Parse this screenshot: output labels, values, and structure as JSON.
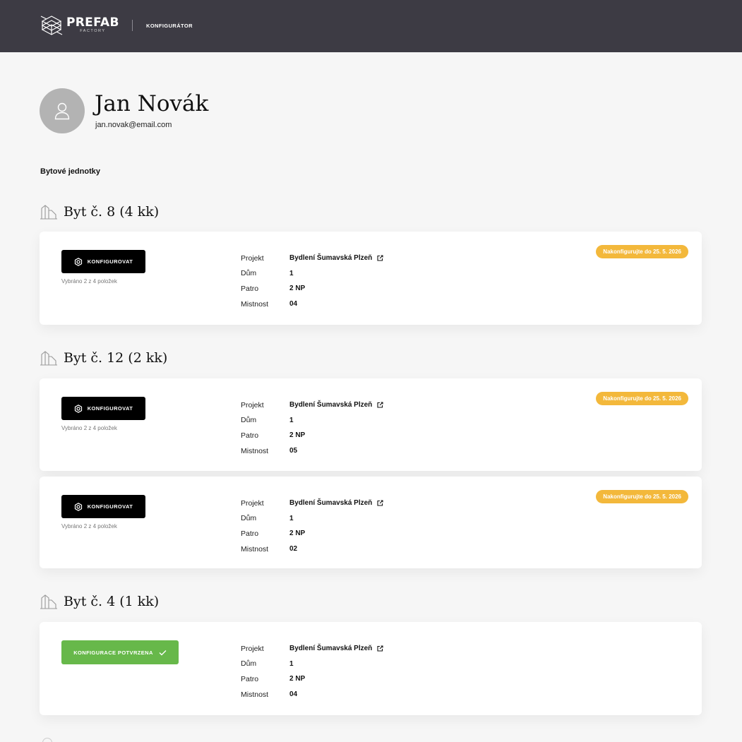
{
  "header": {
    "logo_title": "PREFAB",
    "logo_subtitle": "FACTORY",
    "nav_label": "KONFIGURÁTOR"
  },
  "profile": {
    "name": "Jan Novák",
    "email": "jan.novak@email.com"
  },
  "section_title": "Bytové jednotky",
  "labels": {
    "project": "Projekt",
    "house": "Dům",
    "floor": "Patro",
    "room": "Mistnost",
    "configure": "KONFIGUROVAT",
    "confirmed": "KONFIGURACE POTVRZENA"
  },
  "units": [
    {
      "title": "Byt č. 8 (4 kk)",
      "cards": [
        {
          "status": "pending",
          "selected_note": "Vybráno 2 z 4 položek",
          "project": "Bydlení Šumavská Plzeň",
          "house": "1",
          "floor": "2 NP",
          "room": "04",
          "deadline": "Nakonfigurujte do 25. 5. 2026"
        }
      ]
    },
    {
      "title": "Byt č. 12 (2 kk)",
      "cards": [
        {
          "status": "pending",
          "selected_note": "Vybráno 2 z 4 položek",
          "project": "Bydlení Šumavská Plzeň",
          "house": "1",
          "floor": "2 NP",
          "room": "05",
          "deadline": "Nakonfigurujte do 25. 5. 2026"
        },
        {
          "status": "pending",
          "selected_note": "Vybráno 2 z 4 položek",
          "project": "Bydlení Šumavská Plzeň",
          "house": "1",
          "floor": "2 NP",
          "room": "02",
          "deadline": "Nakonfigurujte do 25. 5. 2026"
        }
      ]
    },
    {
      "title": "Byt č. 4 (1 kk)",
      "cards": [
        {
          "status": "confirmed",
          "project": "Bydlení Šumavská Plzeň",
          "house": "1",
          "floor": "2 NP",
          "room": "04"
        }
      ]
    }
  ],
  "icons": {
    "logo": "prefab-logo-icon",
    "avatar": "user-icon",
    "unit": "house-outline-icon",
    "configure": "gear-icon",
    "project_link": "external-link-icon",
    "confirmed": "check-icon"
  },
  "colors": {
    "header_bg": "#3d3b44",
    "deadline_badge": "#f3b83b",
    "confirmed_button": "#67b84a",
    "configure_button": "#000000"
  }
}
